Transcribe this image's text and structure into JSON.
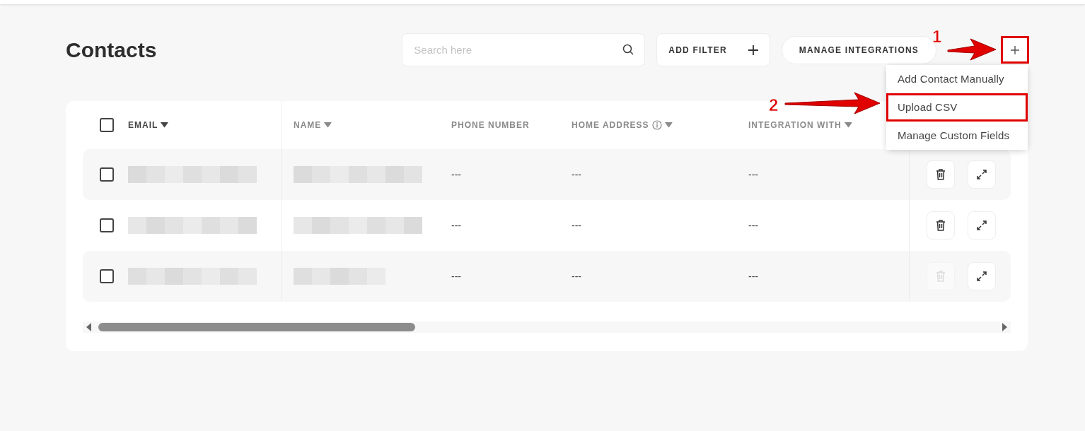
{
  "page_title": "Contacts",
  "search": {
    "placeholder": "Search here"
  },
  "toolbar_buttons": [
    {
      "label": "ADD FILTER",
      "kind": "plus"
    },
    {
      "label": "MANAGE INTEGRATIONS",
      "kind": "pill"
    }
  ],
  "add_menu": {
    "expanded": true,
    "items": [
      {
        "label": "Add Contact Manually",
        "selected": false
      },
      {
        "label": "Upload CSV",
        "selected": true
      },
      {
        "label": "Manage Custom Fields",
        "selected": false
      }
    ]
  },
  "table": {
    "select_all_checked": false,
    "columns": [
      {
        "label": "EMAIL",
        "sortable": true,
        "active": true,
        "info": false
      },
      {
        "label": "NAME",
        "sortable": true,
        "active": false,
        "info": false
      },
      {
        "label": "PHONE NUMBER",
        "sortable": false,
        "active": false,
        "info": false
      },
      {
        "label": "HOME ADDRESS",
        "sortable": true,
        "active": false,
        "info": true
      },
      {
        "label": "INTEGRATION WITH",
        "sortable": true,
        "active": false,
        "info": false
      }
    ],
    "rows": [
      {
        "checked": false,
        "phone": "---",
        "address": "---",
        "integration": "---",
        "delete_disabled": false
      },
      {
        "checked": false,
        "phone": "---",
        "address": "---",
        "integration": "---",
        "delete_disabled": false
      },
      {
        "checked": false,
        "phone": "---",
        "address": "---",
        "integration": "---",
        "delete_disabled": true
      }
    ]
  },
  "annotations": [
    {
      "kind": "arrow",
      "label": "1"
    },
    {
      "kind": "arrow",
      "label": "2"
    }
  ]
}
